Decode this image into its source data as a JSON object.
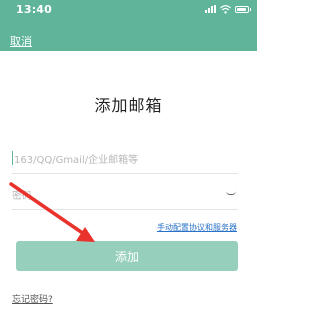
{
  "status_bar": {
    "time": "13:40"
  },
  "header": {
    "cancel_label": "取消"
  },
  "main": {
    "title": "添加邮箱"
  },
  "form": {
    "email_placeholder": "163/QQ/Gmail/企业邮箱等",
    "password_placeholder": "密码",
    "manual_config_link": "手动配置协议和服务器",
    "add_button_label": "添加",
    "forgot_password_link": "忘记密码?"
  },
  "colors": {
    "accent": "#5fb49a",
    "button": "#96d0bc",
    "link": "#2a72c8",
    "annotation_arrow": "#e8322b"
  },
  "icons": [
    "signal-icon",
    "wifi-icon",
    "battery-icon",
    "eye-icon",
    "arrow-annotation"
  ]
}
